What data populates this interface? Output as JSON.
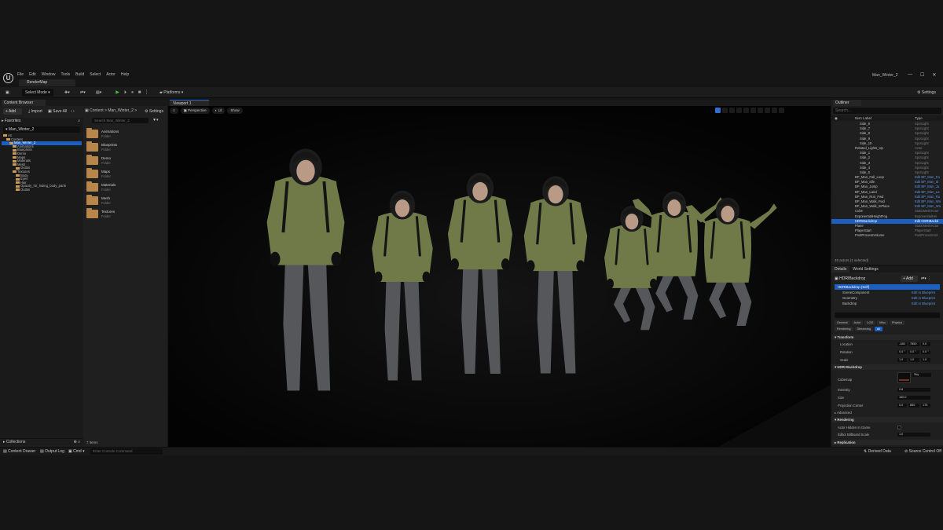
{
  "menu": [
    "File",
    "Edit",
    "Window",
    "Tools",
    "Build",
    "Select",
    "Actor",
    "Help"
  ],
  "map_tab": "RenderMap",
  "project_name": "Man_Winter_2",
  "toolbar": {
    "select_mode": "Select Mode",
    "platforms": "Platforms",
    "settings": "Settings"
  },
  "content_browser": {
    "tab": "Content Browser",
    "add": "+ Add",
    "import": "Import",
    "save_all": "Save All",
    "path": "Content  >  Man_Winter_2  >",
    "settings": "Settings",
    "favorites": "Favorites",
    "tree_root": "Man_Winter_2",
    "search_placeholder": "Search Man_Winter_2",
    "tree": [
      {
        "label": "All",
        "depth": 0,
        "sel": false
      },
      {
        "label": "Content",
        "depth": 1,
        "sel": false
      },
      {
        "label": "Man_Winter_2",
        "depth": 2,
        "sel": true
      },
      {
        "label": "Animations",
        "depth": 3,
        "sel": false
      },
      {
        "label": "Blueprints",
        "depth": 3,
        "sel": false
      },
      {
        "label": "Demo",
        "depth": 3,
        "sel": false
      },
      {
        "label": "Maps",
        "depth": 3,
        "sel": false
      },
      {
        "label": "Materials",
        "depth": 3,
        "sel": false
      },
      {
        "label": "Mesh",
        "depth": 3,
        "sel": false
      },
      {
        "label": "Outfits",
        "depth": 4,
        "sel": false
      },
      {
        "label": "Textures",
        "depth": 3,
        "sel": false
      },
      {
        "label": "Body",
        "depth": 4,
        "sel": false
      },
      {
        "label": "Eyes",
        "depth": 4,
        "sel": false
      },
      {
        "label": "Hair",
        "depth": 4,
        "sel": false
      },
      {
        "label": "Opacity_for_hiding_body_parts",
        "depth": 4,
        "sel": false
      },
      {
        "label": "Outfits",
        "depth": 4,
        "sel": false
      }
    ],
    "assets": [
      {
        "name": "Animations",
        "kind": "Folder"
      },
      {
        "name": "Blueprints",
        "kind": "Folder"
      },
      {
        "name": "Demo",
        "kind": "Folder"
      },
      {
        "name": "Maps",
        "kind": "Folder"
      },
      {
        "name": "Materials",
        "kind": "Folder"
      },
      {
        "name": "Mesh",
        "kind": "Folder"
      },
      {
        "name": "Textures",
        "kind": "Folder"
      }
    ],
    "items_count": "7 items",
    "collections": "Collections"
  },
  "viewport": {
    "tab": "Viewport 1",
    "perspective": "Perspective",
    "lit": "Lit",
    "show": "Show"
  },
  "outliner": {
    "tab": "Outliner",
    "search_placeholder": "Search...",
    "col_label": "Item Label",
    "col_type": "Type",
    "rows": [
      {
        "label": "Side_6",
        "type": "SpotLight",
        "indent": 36,
        "link": false,
        "sel": false
      },
      {
        "label": "Side_7",
        "type": "SpotLight",
        "indent": 36,
        "link": false,
        "sel": false
      },
      {
        "label": "Side_8",
        "type": "SpotLight",
        "indent": 36,
        "link": false,
        "sel": false
      },
      {
        "label": "Side_9",
        "type": "SpotLight",
        "indent": 36,
        "link": false,
        "sel": false
      },
      {
        "label": "Side_10",
        "type": "SpotLight",
        "indent": 36,
        "link": false,
        "sel": false
      },
      {
        "label": "Rotated_Lights_Up",
        "type": "Actor",
        "indent": 30,
        "link": false,
        "sel": false
      },
      {
        "label": "Side_1",
        "type": "SpotLight",
        "indent": 36,
        "link": false,
        "sel": false
      },
      {
        "label": "Side_2",
        "type": "SpotLight",
        "indent": 36,
        "link": false,
        "sel": false
      },
      {
        "label": "Side_3",
        "type": "SpotLight",
        "indent": 36,
        "link": false,
        "sel": false
      },
      {
        "label": "Side_4",
        "type": "SpotLight",
        "indent": 36,
        "link": false,
        "sel": false
      },
      {
        "label": "Side_5",
        "type": "SpotLight",
        "indent": 36,
        "link": false,
        "sel": false
      },
      {
        "label": "BP_Man_Fall_Loop",
        "type": "Edit BP_Man_Fa",
        "indent": 30,
        "link": true,
        "sel": false
      },
      {
        "label": "BP_Man_Idle",
        "type": "Edit BP_Man_Id",
        "indent": 30,
        "link": true,
        "sel": false
      },
      {
        "label": "BP_Man_Jump",
        "type": "Edit BP_Man_Ju",
        "indent": 30,
        "link": true,
        "sel": false
      },
      {
        "label": "BP_Man_Land",
        "type": "Edit BP_Man_La",
        "indent": 30,
        "link": true,
        "sel": false
      },
      {
        "label": "BP_Man_Run_Fwd",
        "type": "Edit BP_Man_Ru",
        "indent": 30,
        "link": true,
        "sel": false
      },
      {
        "label": "BP_Man_Walk_Fwd",
        "type": "Edit BP_Man_Wa",
        "indent": 30,
        "link": true,
        "sel": false
      },
      {
        "label": "BP_Man_Walk_InPlace",
        "type": "Edit BP_Man_Wa",
        "indent": 30,
        "link": true,
        "sel": false
      },
      {
        "label": "Cube",
        "type": "StaticMeshActor",
        "indent": 30,
        "link": false,
        "sel": false
      },
      {
        "label": "ExponentialHeightFog",
        "type": "ExponentialHei",
        "indent": 30,
        "link": false,
        "sel": false
      },
      {
        "label": "HDRIBackdrop",
        "type": "Edit HDRIBackd",
        "indent": 30,
        "link": true,
        "sel": true
      },
      {
        "label": "Plane",
        "type": "StaticMeshActor",
        "indent": 30,
        "link": false,
        "sel": false
      },
      {
        "label": "PlayerStart",
        "type": "PlayerStart",
        "indent": 30,
        "link": false,
        "sel": false
      },
      {
        "label": "PostProcessVolume",
        "type": "PostProcessVol",
        "indent": 30,
        "link": false,
        "sel": false
      }
    ],
    "count": "45 actors (1 selected)"
  },
  "details": {
    "tab": "Details",
    "world_tab": "World Settings",
    "actor": "HDRIBackdrop",
    "add": "+ Add",
    "components": [
      {
        "label": "HDRIBackdrop (Self)",
        "action": "",
        "sel": true
      },
      {
        "label": "SceneComponent",
        "action": "Edit in Blueprint",
        "sel": false
      },
      {
        "label": "Geometry",
        "action": "Edit in Blueprint",
        "sel": false
      },
      {
        "label": "Backdrop",
        "action": "Edit in Blueprint",
        "sel": false
      }
    ],
    "filters1": [
      "General",
      "Actor",
      "LOD",
      "Misc",
      "Physics"
    ],
    "filters2": [
      "Rendering",
      "Streaming",
      "All"
    ],
    "transform": "Transform",
    "location": "Location",
    "location_vals": [
      "-185",
      "7850",
      "0.0"
    ],
    "rotation": "Rotation",
    "rotation_vals": [
      "0.0 °",
      "0.0 °",
      "0.0 °"
    ],
    "scale": "Scale",
    "scale_vals": [
      "1.0",
      "1.0",
      "1.0"
    ],
    "hdri_section": "HDRI Backdrop",
    "cubemap": "Cubemap",
    "cubemap_value": "Sky",
    "intensity": "Intensity",
    "intensity_value": "0.8",
    "size": "Size",
    "size_value": "150.0",
    "projection_center": "Projection Center",
    "projection_vals": [
      "0.0",
      "850",
      "175"
    ],
    "advanced": "Advanced",
    "rendering": "Rendering",
    "actor_hidden": "Actor Hidden In Game",
    "billboard_scale": "Editor Billboard Scale",
    "billboard_value": "1.0",
    "replication": "Replication"
  },
  "statusbar": {
    "content_drawer": "Content Drawer",
    "output_log": "Output Log",
    "cmd": "Cmd",
    "cmd_placeholder": "Enter Console Command",
    "derived_data": "Derived Data",
    "source_control": "Source Control Off"
  },
  "colors": {
    "accent": "#1d5fbf",
    "jacket": "#6f7a48",
    "pants": "#55575a",
    "hood": "#1c1c1c",
    "folder": "#b8864a"
  }
}
